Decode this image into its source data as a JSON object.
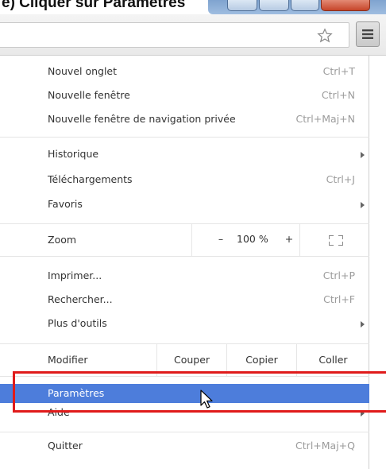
{
  "cropped_heading": "e) Cliquer sur Paramètres",
  "toolbar": {
    "star_icon": "star-outline",
    "menu_icon": "hamburger"
  },
  "menu": {
    "new_tab": {
      "label": "Nouvel onglet",
      "shortcut": "Ctrl+T"
    },
    "new_window": {
      "label": "Nouvelle fenêtre",
      "shortcut": "Ctrl+N"
    },
    "incognito": {
      "label": "Nouvelle fenêtre de navigation privée",
      "shortcut": "Ctrl+Maj+N"
    },
    "history": {
      "label": "Historique"
    },
    "downloads": {
      "label": "Téléchargements",
      "shortcut": "Ctrl+J"
    },
    "bookmarks": {
      "label": "Favoris"
    },
    "zoom": {
      "label": "Zoom",
      "minus": "–",
      "value": "100 %",
      "plus": "+"
    },
    "print": {
      "label": "Imprimer...",
      "shortcut": "Ctrl+P"
    },
    "find": {
      "label": "Rechercher...",
      "shortcut": "Ctrl+F"
    },
    "more_tools": {
      "label": "Plus d'outils"
    },
    "edit": {
      "label": "Modifier",
      "cut": "Couper",
      "copy": "Copier",
      "paste": "Coller"
    },
    "settings": {
      "label": "Paramètres"
    },
    "help": {
      "label": "Aide"
    },
    "quit": {
      "label": "Quitter",
      "shortcut": "Ctrl+Maj+Q"
    }
  },
  "colors": {
    "highlight": "#4d7ddb",
    "annotation": "#e01b1b",
    "shortcut_text": "#9b9b9b"
  }
}
